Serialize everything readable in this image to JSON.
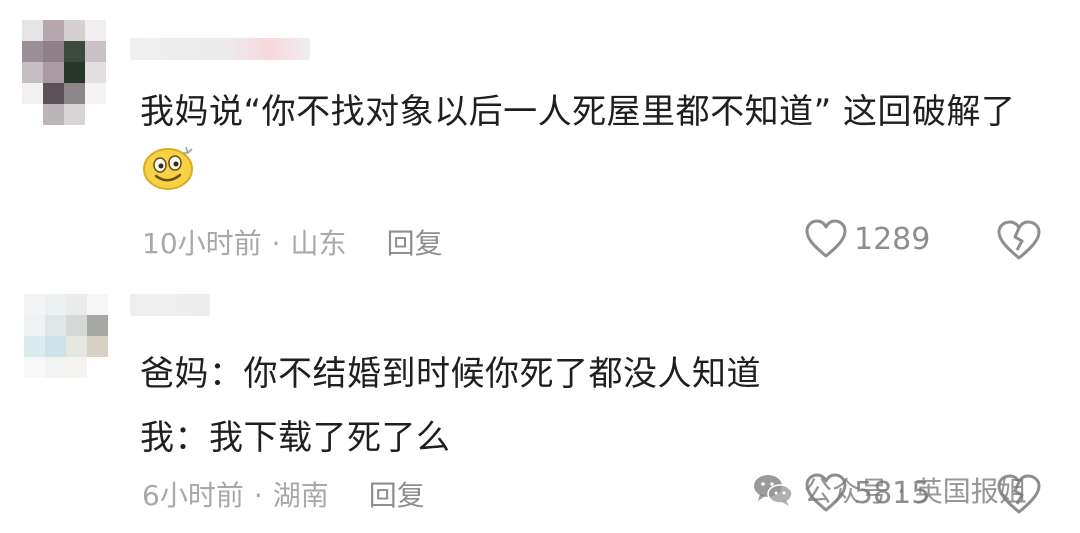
{
  "comments": [
    {
      "text": "我妈说“你不找对象以后一人死屋里都不知道” 这回破解了",
      "emoji": "smile-emoji",
      "time": "10小时前",
      "separator": "·",
      "location": "山东",
      "reply_label": "回复",
      "like_count": "1289"
    },
    {
      "lines": [
        "爸妈：你不结婚到时候你死了都没人知道",
        "我：我下载了死了么"
      ],
      "time": "6小时前",
      "separator": "·",
      "location": "湖南",
      "reply_label": "回复",
      "like_count": "5815"
    }
  ],
  "watermark": {
    "text": "公众号 · 英国报姐",
    "icon": "wechat-icon"
  },
  "colors": {
    "text": "#1f1f1f",
    "meta": "#a8a8a8",
    "icon": "#8e8e8e"
  }
}
